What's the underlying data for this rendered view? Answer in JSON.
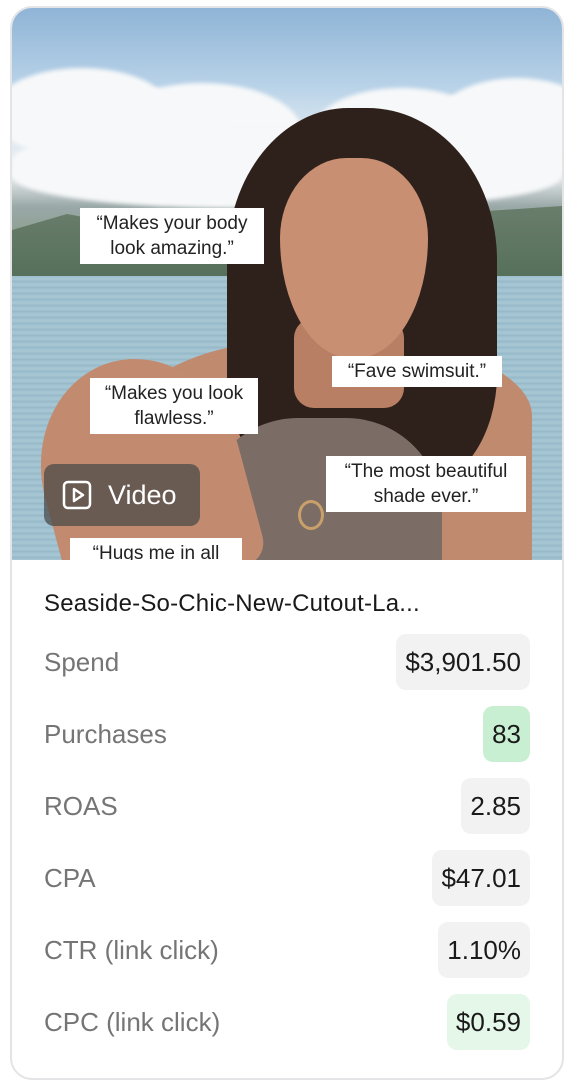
{
  "media": {
    "type_label": "Video",
    "icon": "play-icon",
    "quotes": [
      "“Makes your body\nlook amazing.”",
      "“Fave swimsuit.”",
      "“Makes you look\nflawless.”",
      "“The most beautiful\nshade ever.”",
      "“Hugs me in all"
    ]
  },
  "ad": {
    "title": "Seaside-So-Chic-New-Cutout-La...",
    "metrics": [
      {
        "label": "Spend",
        "value": "$3,901.50",
        "bg": "#f2f2f3"
      },
      {
        "label": "Purchases",
        "value": "83",
        "bg": "#c9efd3"
      },
      {
        "label": "ROAS",
        "value": "2.85",
        "bg": "#f2f2f3"
      },
      {
        "label": "CPA",
        "value": "$47.01",
        "bg": "#f2f2f3"
      },
      {
        "label": "CTR (link click)",
        "value": "1.10%",
        "bg": "#f2f2f3"
      },
      {
        "label": "CPC (link click)",
        "value": "$0.59",
        "bg": "#e4f7e9"
      }
    ]
  }
}
